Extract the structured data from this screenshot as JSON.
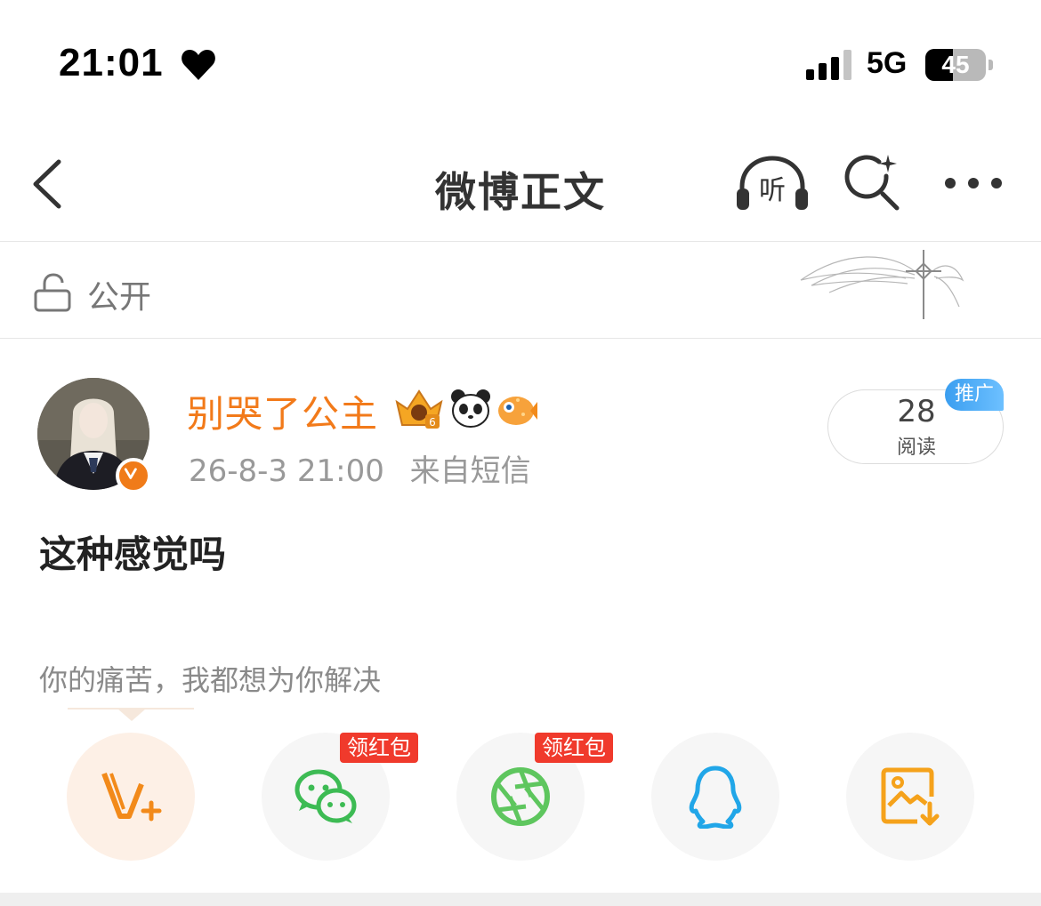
{
  "status_bar": {
    "time": "21:01",
    "network": "5G",
    "battery": "45",
    "battery_level": 0.45
  },
  "nav": {
    "title": "微博正文",
    "listen_label": "听"
  },
  "visibility": {
    "label": "公开"
  },
  "post": {
    "username": "别哭了公主",
    "date": "26-8-3 21:00",
    "source": "来自短信",
    "text": "这种感觉吗",
    "read_count": "28",
    "read_label": "阅读",
    "promo_tag": "推广",
    "username_color": "#f27a1a"
  },
  "share": {
    "prompt": "你的痛苦，我都想为你解决",
    "red_packet_label": "领红包",
    "buttons": [
      {
        "icon": "vplus-icon"
      },
      {
        "icon": "wechat-icon"
      },
      {
        "icon": "moments-icon"
      },
      {
        "icon": "qq-icon"
      },
      {
        "icon": "save-image-icon"
      }
    ]
  }
}
